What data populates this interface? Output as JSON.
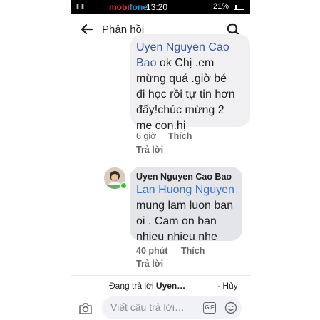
{
  "status_bar": {
    "signal": "ıll ıll",
    "carrier_mobi": "mobi",
    "carrier_fone": "fone",
    "time": "13:20",
    "battery": "21%"
  },
  "header": {
    "title": "Phản hồi",
    "back_icon": "arrow-left-icon",
    "search_icon": "search-icon"
  },
  "comments": [
    {
      "author": "Uyen Nguyen Cao",
      "text_line1_start": "Bao",
      "text_line1_rest": " ok Chị .em",
      "text_lines": [
        "mừng quá .giờ bé",
        "đi học rồi tự tin hơn",
        "đấy!chúc mừng 2",
        "me con.hị"
      ],
      "time": "6 giờ",
      "like": "Thích",
      "reply": "Trả lời"
    },
    {
      "author": "Uyen Nguyen Cao Bao",
      "mention": "Lan Huong Nguyen",
      "text_lines": [
        "mung lam luon ban",
        "oi . Cam on ban",
        "nhieu nhieu nhe"
      ],
      "time": "40 phút",
      "like": "Thích",
      "reply": "Trả lời"
    }
  ],
  "reply_bar": {
    "replying_prefix": "Đang trả lời ",
    "replying_name": "Uyen…",
    "cancel": "· Hủy"
  },
  "composer": {
    "placeholder": "Viết câu trả lời…",
    "gif": "GIF"
  }
}
